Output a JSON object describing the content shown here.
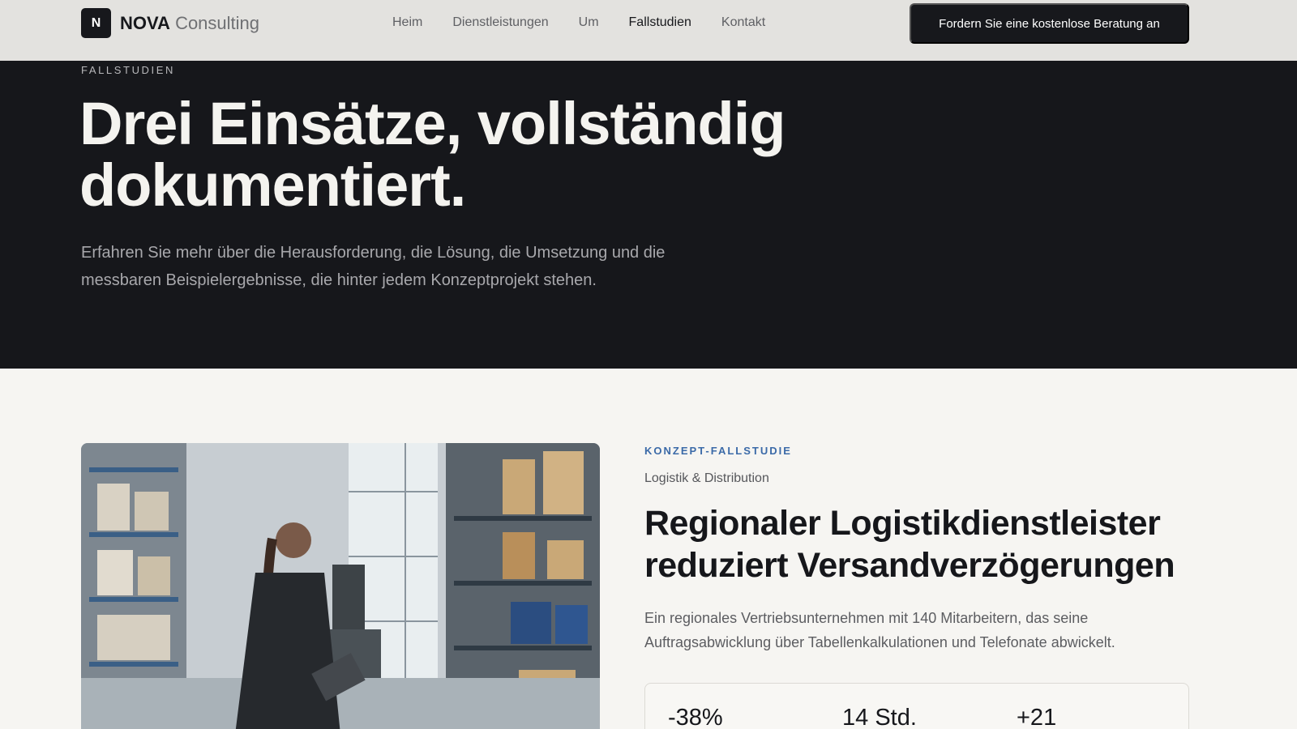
{
  "header": {
    "logo_mark": "N",
    "logo_strong": "NOVA",
    "logo_light": "Consulting",
    "nav": [
      "Heim",
      "Dienstleistungen",
      "Um",
      "Fallstudien",
      "Kontakt"
    ],
    "active_nav": "Fallstudien",
    "cta_label": "Fordern Sie eine kostenlose Beratung an"
  },
  "hero": {
    "eyebrow": "FALLSTUDIEN",
    "title_line1": "Drei Einsätze, vollständig",
    "title_line2": "dokumentiert.",
    "subtitle_line1": "Erfahren Sie mehr über die Herausforderung, die Lösung, die Umsetzung und die",
    "subtitle_line2": "messbaren Beispielergebnisse, die hinter jedem Konzeptprojekt stehen."
  },
  "case_study": {
    "label": "KONZEPT-FALLSTUDIE",
    "category": "Logistik & Distribution",
    "title_line1": "Regionaler Logistikdienstleister",
    "title_line2": "reduziert Versandverzögerungen",
    "description_line1": "Ein regionales Vertriebsunternehmen mit 140 Mitarbeitern, das seine",
    "description_line2": "Auftragsabwicklung über Tabellenkalkulationen und Telefonate abwickelt.",
    "stats": [
      "-38%",
      "14 Std.",
      "+21"
    ]
  },
  "colors": {
    "dark": "#16171b",
    "header_bg": "#e3e2df",
    "page_bg": "#f6f5f2",
    "accent_blue": "#3b6aa8"
  }
}
